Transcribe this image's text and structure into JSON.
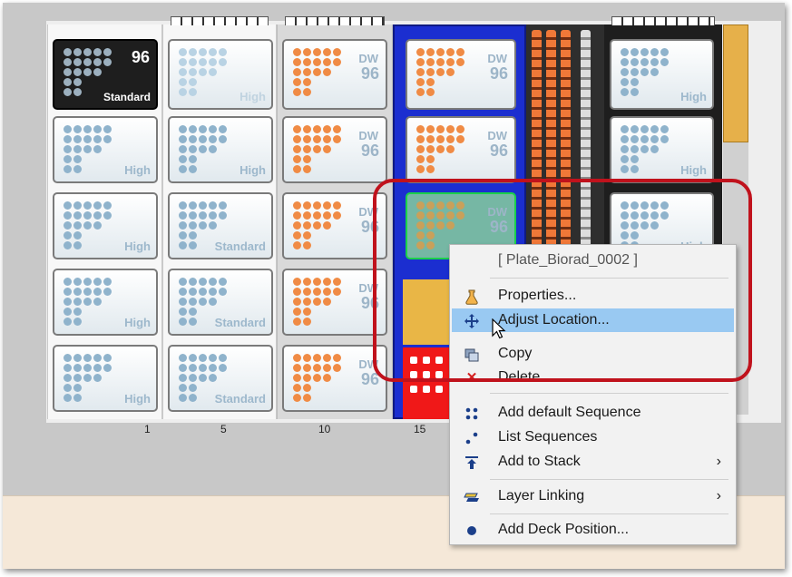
{
  "racks": [
    {
      "id": "rack-1",
      "plates": [
        {
          "type": "dark",
          "label": "Standard",
          "count": "96"
        },
        {
          "type": "high",
          "label": "High"
        },
        {
          "type": "high",
          "label": "High"
        },
        {
          "type": "high",
          "label": "High"
        },
        {
          "type": "high",
          "label": "High"
        }
      ]
    },
    {
      "id": "rack-5",
      "plates": [
        {
          "type": "light",
          "label": "High"
        },
        {
          "type": "high",
          "label": "High"
        },
        {
          "type": "standard",
          "label": "Standard"
        },
        {
          "type": "standard",
          "label": "Standard"
        },
        {
          "type": "standard",
          "label": "Standard"
        }
      ]
    },
    {
      "id": "rack-10",
      "plates": [
        {
          "type": "dw",
          "line1": "DW",
          "line2": "96"
        },
        {
          "type": "dw",
          "line1": "DW",
          "line2": "96"
        },
        {
          "type": "dw",
          "line1": "DW",
          "line2": "96"
        },
        {
          "type": "dw",
          "line1": "DW",
          "line2": "96"
        },
        {
          "type": "dw",
          "line1": "DW",
          "line2": "96"
        }
      ]
    },
    {
      "id": "rack-15",
      "plates": [
        {
          "type": "dw",
          "line1": "DW",
          "line2": "96"
        },
        {
          "type": "dw",
          "line1": "DW",
          "line2": "96"
        },
        {
          "type": "sel",
          "line1": "DW",
          "line2": "96"
        }
      ]
    },
    {
      "id": "rack-right",
      "plates": [
        {
          "type": "high",
          "label": "High"
        },
        {
          "type": "high",
          "label": "High"
        },
        {
          "type": "high",
          "label": "High"
        }
      ]
    }
  ],
  "column_numbers": [
    "1",
    "5",
    "10",
    "15"
  ],
  "context_menu": {
    "header": "[ Plate_Biorad_0002 ]",
    "items": [
      {
        "label": "Properties...",
        "icon": "flask-icon"
      },
      {
        "label": "Adjust Location...",
        "icon": "move-icon",
        "highlighted": true
      },
      {
        "label": "Copy",
        "icon": "copy-icon"
      },
      {
        "label": "Delete",
        "icon": "delete-icon"
      },
      {
        "label": "Add default Sequence",
        "icon": "sequence-icon"
      },
      {
        "label": "List Sequences",
        "icon": "list-sequences-icon"
      },
      {
        "label": "Add to Stack",
        "icon": "stack-icon",
        "submenu": true
      },
      {
        "label": "Layer Linking",
        "icon": "layer-link-icon",
        "submenu": true
      },
      {
        "label": "Add Deck Position...",
        "icon": "deck-position-icon"
      }
    ]
  },
  "colors": {
    "menu_highlight": "#99c9f2",
    "annotation_red": "#c0121c",
    "dw_dots": "#f08b45",
    "blue_rack": "#1b2ed0"
  }
}
